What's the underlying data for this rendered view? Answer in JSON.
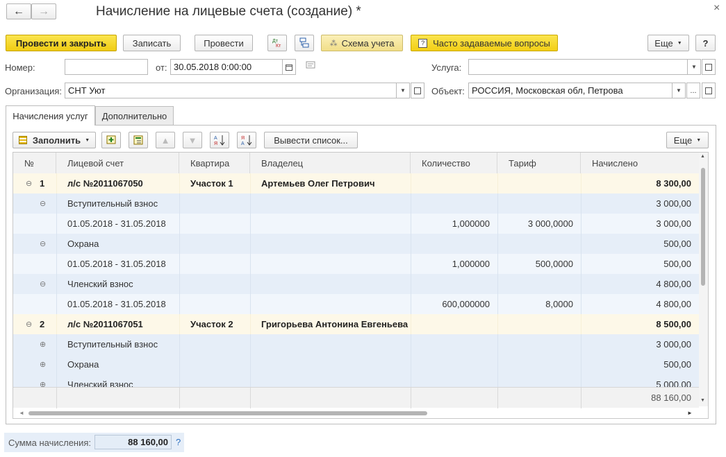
{
  "window": {
    "title": "Начисление на лицевые счета (создание) *",
    "close_glyph": "×"
  },
  "nav": {
    "back": "←",
    "forward": "→"
  },
  "toolbar": {
    "post_close": "Провести и закрыть",
    "save": "Записать",
    "post": "Провести",
    "dt_kt": "Дт Кт",
    "scheme": "Схема учета",
    "faq": "Часто задаваемые вопросы",
    "more": "Еще",
    "help": "?"
  },
  "form": {
    "number_label": "Номер:",
    "number_value": "",
    "date_label": "от:",
    "date_value": "30.05.2018  0:00:00",
    "service_label": "Услуга:",
    "service_value": "",
    "org_label": "Организация:",
    "org_value": "СНТ Уют",
    "object_label": "Объект:",
    "object_value": "РОССИЯ, Московская обл, Петрова",
    "ellipsis": "..."
  },
  "tabs": [
    "Начисления услуг",
    "Дополнительно"
  ],
  "table_toolbar": {
    "fill": "Заполнить",
    "output_list": "Вывести список...",
    "more": "Еще"
  },
  "table": {
    "columns": [
      "№",
      "Лицевой счет",
      "Квартира",
      "Владелец",
      "Количество",
      "Тариф",
      "Начислено"
    ],
    "rows": [
      {
        "level": 0,
        "toggle": "⊖",
        "num": "1",
        "account": "л/с №2011067050",
        "flat": "Участок 1",
        "owner": "Артемьев Олег Петрович",
        "qty": "",
        "tariff": "",
        "amount": "8 300,00"
      },
      {
        "level": 1,
        "toggle": "⊖",
        "num": "",
        "account": "Вступительный взнос",
        "flat": "",
        "owner": "",
        "qty": "",
        "tariff": "",
        "amount": "3 000,00"
      },
      {
        "level": 2,
        "toggle": "",
        "num": "",
        "account": "01.05.2018 - 31.05.2018",
        "flat": "",
        "owner": "",
        "qty": "1,000000",
        "tariff": "3 000,0000",
        "amount": "3 000,00"
      },
      {
        "level": 1,
        "toggle": "⊖",
        "num": "",
        "account": "Охрана",
        "flat": "",
        "owner": "",
        "qty": "",
        "tariff": "",
        "amount": "500,00"
      },
      {
        "level": 2,
        "toggle": "",
        "num": "",
        "account": "01.05.2018 - 31.05.2018",
        "flat": "",
        "owner": "",
        "qty": "1,000000",
        "tariff": "500,0000",
        "amount": "500,00"
      },
      {
        "level": 1,
        "toggle": "⊖",
        "num": "",
        "account": "Членский взнос",
        "flat": "",
        "owner": "",
        "qty": "",
        "tariff": "",
        "amount": "4 800,00"
      },
      {
        "level": 2,
        "toggle": "",
        "num": "",
        "account": "01.05.2018 - 31.05.2018",
        "flat": "",
        "owner": "",
        "qty": "600,000000",
        "tariff": "8,0000",
        "amount": "4 800,00"
      },
      {
        "level": 0,
        "toggle": "⊖",
        "num": "2",
        "account": "л/с №2011067051",
        "flat": "Участок 2",
        "owner": "Григорьева Антонина Евгеньева",
        "qty": "",
        "tariff": "",
        "amount": "8 500,00"
      },
      {
        "level": 1,
        "toggle": "⊕",
        "num": "",
        "account": "Вступительный взнос",
        "flat": "",
        "owner": "",
        "qty": "",
        "tariff": "",
        "amount": "3 000,00"
      },
      {
        "level": 1,
        "toggle": "⊕",
        "num": "",
        "account": "Охрана",
        "flat": "",
        "owner": "",
        "qty": "",
        "tariff": "",
        "amount": "500,00"
      },
      {
        "level": 1,
        "toggle": "⊕",
        "num": "",
        "account": "Членский взнос",
        "flat": "",
        "owner": "",
        "qty": "",
        "tariff": "",
        "amount": "5 000,00"
      }
    ],
    "footer_total": "88 160,00"
  },
  "summary": {
    "label": "Сумма начисления:",
    "value": "88 160,00",
    "help": "?"
  },
  "colors": {
    "yellow_button": "#f3cf14",
    "group_row": "#fdf8e8",
    "sub_row": "#e6eef8",
    "detail_row": "#f1f6fc"
  }
}
